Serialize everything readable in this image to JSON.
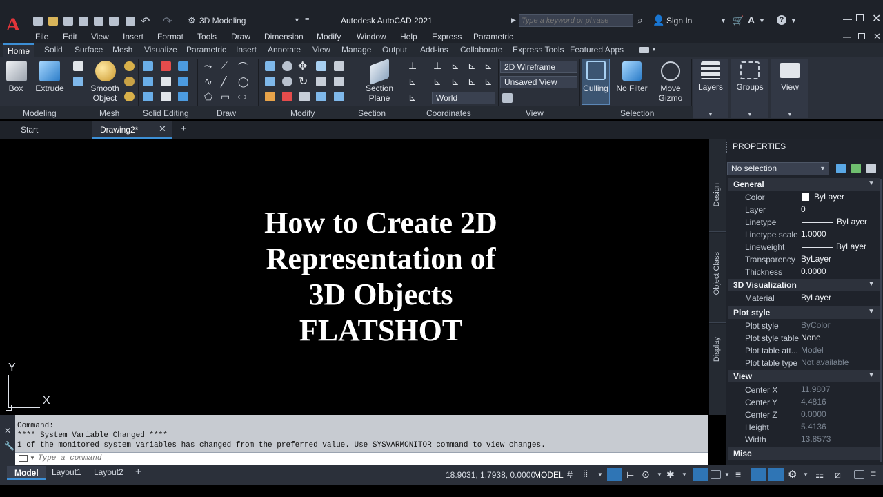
{
  "app": {
    "title": "Autodesk AutoCAD 2021",
    "logo_letter": "A",
    "workspace": "3D Modeling",
    "search_placeholder": "Type a keyword or phrase",
    "sign_in": "Sign In"
  },
  "menu": [
    "File",
    "Edit",
    "View",
    "Insert",
    "Format",
    "Tools",
    "Draw",
    "Dimension",
    "Modify",
    "Window",
    "Help",
    "Express",
    "Parametric"
  ],
  "ribbon_tabs": [
    "Home",
    "Solid",
    "Surface",
    "Mesh",
    "Visualize",
    "Parametric",
    "Insert",
    "Annotate",
    "View",
    "Manage",
    "Output",
    "Add-ins",
    "Collaborate",
    "Express Tools",
    "Featured Apps"
  ],
  "ribbon": {
    "box": "Box",
    "extrude": "Extrude",
    "smooth_object_1": "Smooth",
    "smooth_object_2": "Object",
    "section_plane_1": "Section",
    "section_plane_2": "Plane",
    "visual_style": "2D Wireframe",
    "saved_view": "Unsaved View",
    "ucs": "World",
    "culling": "Culling",
    "no_filter": "No Filter",
    "move_gizmo_1": "Move",
    "move_gizmo_2": "Gizmo",
    "layers": "Layers",
    "groups": "Groups",
    "view": "View",
    "panels": {
      "modeling": "Modeling",
      "mesh": "Mesh",
      "solid_editing": "Solid Editing",
      "draw": "Draw",
      "modify": "Modify",
      "section": "Section",
      "coordinates": "Coordinates",
      "view": "View",
      "selection": "Selection"
    }
  },
  "doc_tabs": {
    "start": "Start",
    "drawing": "Drawing2*"
  },
  "canvas": {
    "lines": [
      "How to Create 2D",
      "Representation of",
      "3D Objects",
      "FLATSHOT"
    ],
    "ucs_x": "X",
    "ucs_y": "Y"
  },
  "side_tabs": [
    "Design",
    "Object Class",
    "Display"
  ],
  "properties": {
    "header": "PROPERTIES",
    "selection": "No selection",
    "general": {
      "title": "General",
      "rows": [
        {
          "name": "Color",
          "value": "ByLayer"
        },
        {
          "name": "Layer",
          "value": "0"
        },
        {
          "name": "Linetype",
          "value": "ByLayer"
        },
        {
          "name": "Linetype scale",
          "value": "1.0000"
        },
        {
          "name": "Lineweight",
          "value": "ByLayer"
        },
        {
          "name": "Transparency",
          "value": "ByLayer"
        },
        {
          "name": "Thickness",
          "value": "0.0000"
        }
      ]
    },
    "viz": {
      "title": "3D Visualization",
      "rows": [
        {
          "name": "Material",
          "value": "ByLayer"
        }
      ]
    },
    "plot": {
      "title": "Plot style",
      "rows": [
        {
          "name": "Plot style",
          "value": "ByColor"
        },
        {
          "name": "Plot style table",
          "value": "None"
        },
        {
          "name": "Plot table att...",
          "value": "Model"
        },
        {
          "name": "Plot table type",
          "value": "Not available"
        }
      ]
    },
    "view": {
      "title": "View",
      "rows": [
        {
          "name": "Center X",
          "value": "11.9807"
        },
        {
          "name": "Center Y",
          "value": "4.4816"
        },
        {
          "name": "Center Z",
          "value": "0.0000"
        },
        {
          "name": "Height",
          "value": "5.4136"
        },
        {
          "name": "Width",
          "value": "13.8573"
        }
      ]
    },
    "misc": {
      "title": "Misc"
    }
  },
  "command": {
    "history": [
      "Command:",
      "**** System Variable Changed ****",
      "1 of the monitored system variables has changed from the preferred value. Use SYSVARMONITOR command to view changes."
    ],
    "placeholder": "Type a command"
  },
  "layout_tabs": [
    "Model",
    "Layout1",
    "Layout2"
  ],
  "status": {
    "coords": "18.9031, 1.7938, 0.0000",
    "space": "MODEL"
  },
  "colors": {
    "accent": "#3c8fd6",
    "logo": "#e2353a",
    "ribbon_bg": "#2b303a",
    "title_bg": "#1e2229"
  }
}
